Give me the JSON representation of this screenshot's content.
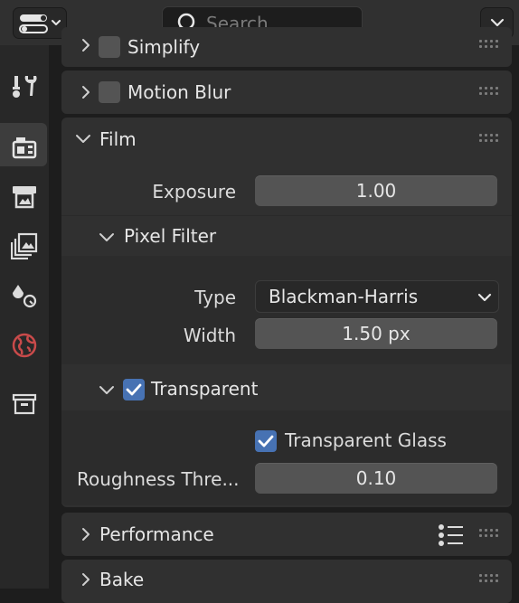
{
  "header": {
    "search_placeholder": "Search"
  },
  "tabs": [
    {
      "name": "tool-tab",
      "icon": "wrench-screwdriver-icon"
    },
    {
      "name": "render-tab",
      "icon": "camera-back-icon",
      "active": true
    },
    {
      "name": "output-tab",
      "icon": "printer-icon"
    },
    {
      "name": "view-layer-tab",
      "icon": "images-icon"
    },
    {
      "name": "scene-tab",
      "icon": "scene-icon"
    },
    {
      "name": "world-tab",
      "icon": "globe-icon"
    },
    {
      "name": "collection-tab",
      "icon": "archive-box-icon"
    }
  ],
  "panels": {
    "simplify": {
      "label": "Simplify",
      "enabled": false
    },
    "motion_blur": {
      "label": "Motion Blur",
      "enabled": false
    },
    "film": {
      "label": "Film",
      "exposure_label": "Exposure",
      "exposure_value": "1.00",
      "pixel_filter": {
        "label": "Pixel Filter",
        "type_label": "Type",
        "type_value": "Blackman-Harris",
        "width_label": "Width",
        "width_value": "1.50 px"
      },
      "transparent": {
        "label": "Transparent",
        "enabled": true,
        "glass_label": "Transparent Glass",
        "glass_enabled": true,
        "roughness_label": "Roughness Thre...",
        "roughness_value": "0.10"
      }
    },
    "performance": {
      "label": "Performance"
    },
    "bake": {
      "label": "Bake"
    }
  },
  "colors": {
    "accent": "#4772b3",
    "panel": "#303030",
    "field": "#545454",
    "background": "#1d1d1d"
  }
}
